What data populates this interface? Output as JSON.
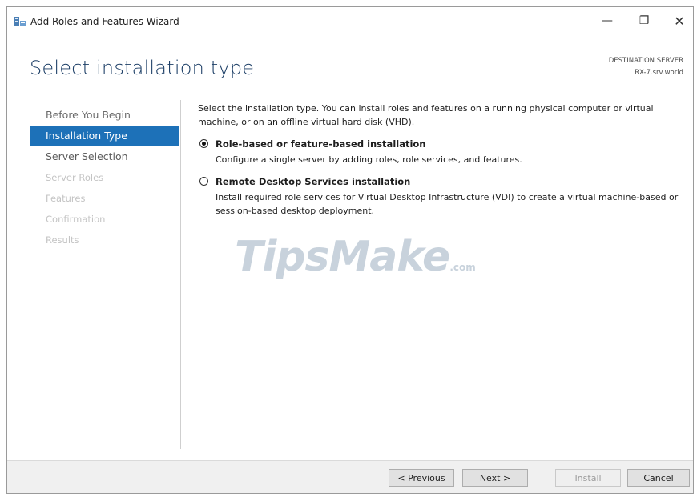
{
  "window": {
    "title": "Add Roles and Features Wizard",
    "controls": {
      "minimize": "—",
      "maximize": "❐",
      "close": "✕"
    }
  },
  "header": {
    "page_title": "Select installation type",
    "destination_label": "DESTINATION SERVER",
    "destination_server": "RX-7.srv.world"
  },
  "sidebar": {
    "items": [
      {
        "label": "Before You Begin",
        "state": "done"
      },
      {
        "label": "Installation Type",
        "state": "active"
      },
      {
        "label": "Server Selection",
        "state": "enabled"
      },
      {
        "label": "Server Roles",
        "state": "disabled"
      },
      {
        "label": "Features",
        "state": "disabled"
      },
      {
        "label": "Confirmation",
        "state": "disabled"
      },
      {
        "label": "Results",
        "state": "disabled"
      }
    ]
  },
  "main": {
    "intro": "Select the installation type. You can install roles and features on a running physical computer or virtual machine, or on an offline virtual hard disk (VHD).",
    "options": [
      {
        "title": "Role-based or feature-based installation",
        "description": "Configure a single server by adding roles, role services, and features.",
        "selected": true
      },
      {
        "title": "Remote Desktop Services installation",
        "description": "Install required role services for Virtual Desktop Infrastructure (VDI) to create a virtual machine-based or session-based desktop deployment.",
        "selected": false
      }
    ]
  },
  "watermark": {
    "text": "TipsMake",
    "tail": ".com"
  },
  "footer": {
    "previous_label": "< Previous",
    "next_label": "Next >",
    "install_label": "Install",
    "cancel_label": "Cancel"
  },
  "colors": {
    "accent": "#1d71b8",
    "title": "#1c3e66"
  }
}
